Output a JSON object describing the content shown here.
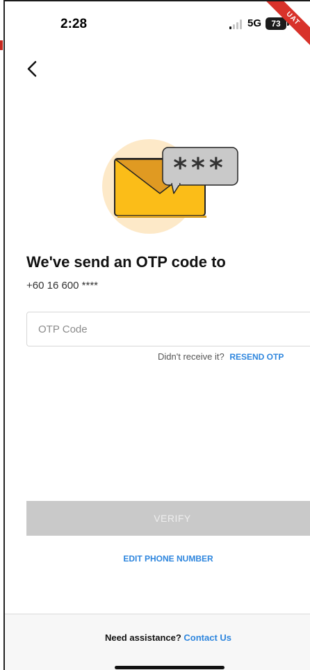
{
  "status_bar": {
    "time": "2:28",
    "network": "5G",
    "battery": "73",
    "ribbon": "UAT",
    "icons": [
      "signal-icon",
      "battery-icon"
    ]
  },
  "header": {
    "back_icon": "chevron-left-icon"
  },
  "illustration": {
    "icon": "envelope-password-icon",
    "bubble_text": "***",
    "colors": {
      "circle": "#fde9c8",
      "envelope": "#fbbd18",
      "flap": "#e09a22",
      "bubble": "#c9c9c9"
    }
  },
  "content": {
    "heading": "We've send an OTP code to",
    "phone_number": "+60 16 600 ****"
  },
  "otp_input": {
    "placeholder": "OTP Code",
    "value": ""
  },
  "resend": {
    "prompt": "Didn't receive it?",
    "link": "RESEND OTP"
  },
  "actions": {
    "verify": "VERIFY",
    "edit_phone": "EDIT PHONE NUMBER"
  },
  "footer": {
    "assist_text": "Need assistance?",
    "contact_link": "Contact Us"
  },
  "colors": {
    "link": "#2e86de",
    "disabled_button": "#c9c9c9",
    "ribbon": "#d8322a"
  }
}
